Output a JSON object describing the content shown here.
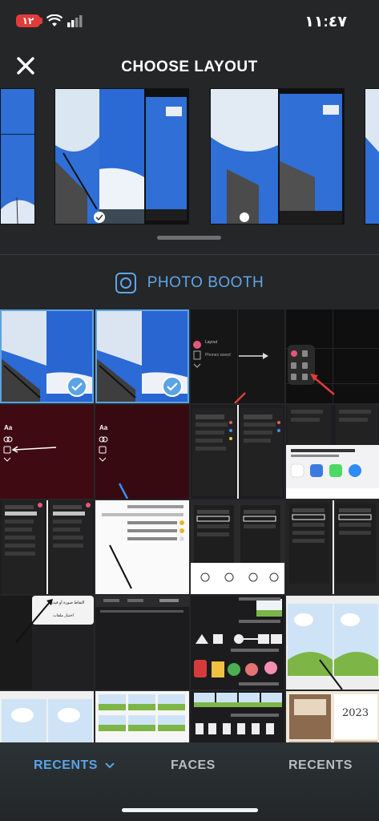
{
  "status_bar": {
    "time": "١١:٤٧",
    "battery": "١٢"
  },
  "header": {
    "title": "CHOOSE LAYOUT",
    "close_icon": "close-icon"
  },
  "photo_booth": {
    "label": "PHOTO BOOTH",
    "icon": "photo-booth-icon"
  },
  "grid_thumbs": {
    "layout_label": "Layout",
    "phones_label": "Phones saved",
    "aa_label": "Aa",
    "menu_item_1": "التقاط صورة أو فيديو",
    "menu_item_2": "اختيار ملفات",
    "year_label": "2023"
  },
  "tab_bar": {
    "recents_label": "RECENTS",
    "faces_label": "FACES",
    "recents2_label": "RECENTS"
  },
  "colors": {
    "accent": "#5aa3e6",
    "background": "#252628",
    "sky": "#2f6fd6",
    "red_arrow": "#e23b3b"
  }
}
